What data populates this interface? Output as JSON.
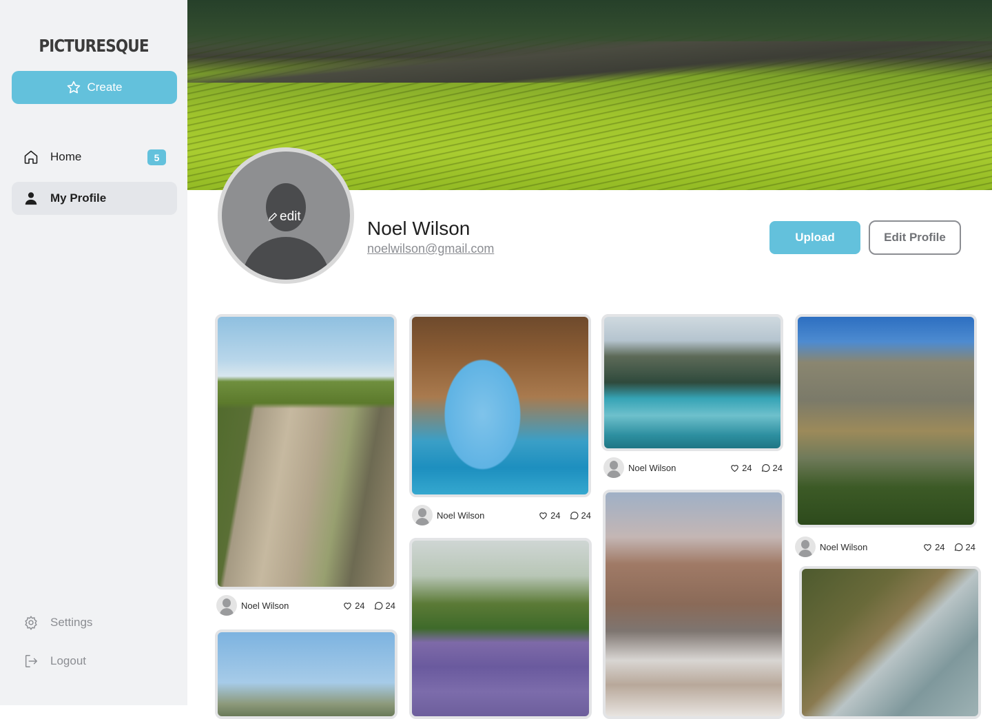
{
  "app": {
    "logo": "PICTURESQUE",
    "accent": "#63c1dc"
  },
  "sidebar": {
    "create_label": "Create",
    "items": [
      {
        "label": "Home",
        "icon": "home-icon",
        "badge": "5"
      },
      {
        "label": "My Profile",
        "icon": "user-icon",
        "active": true
      }
    ],
    "bottom_items": [
      {
        "label": "Settings",
        "icon": "gear-icon"
      },
      {
        "label": "Logout",
        "icon": "logout-icon"
      }
    ]
  },
  "profile": {
    "name": "Noel Wilson",
    "email": "noelwilson@gmail.com",
    "avatar_edit_label": "edit",
    "upload_label": "Upload",
    "edit_profile_label": "Edit Profile"
  },
  "posts": [
    {
      "author": "Noel Wilson",
      "likes": "24",
      "comments": "24",
      "image": "coastal-cliff"
    },
    {
      "author": "Noel Wilson",
      "likes": "24",
      "comments": "24",
      "image": "sea-arch"
    },
    {
      "author": "Noel Wilson",
      "likes": "24",
      "comments": "24",
      "image": "mountain-lake"
    },
    {
      "author": "Noel Wilson",
      "likes": "24",
      "comments": "24",
      "image": "canyon-valley"
    },
    {
      "image": "mountain-ridge"
    },
    {
      "image": "lavender-field"
    },
    {
      "image": "dolomite-village"
    },
    {
      "image": "green-cliff"
    }
  ]
}
